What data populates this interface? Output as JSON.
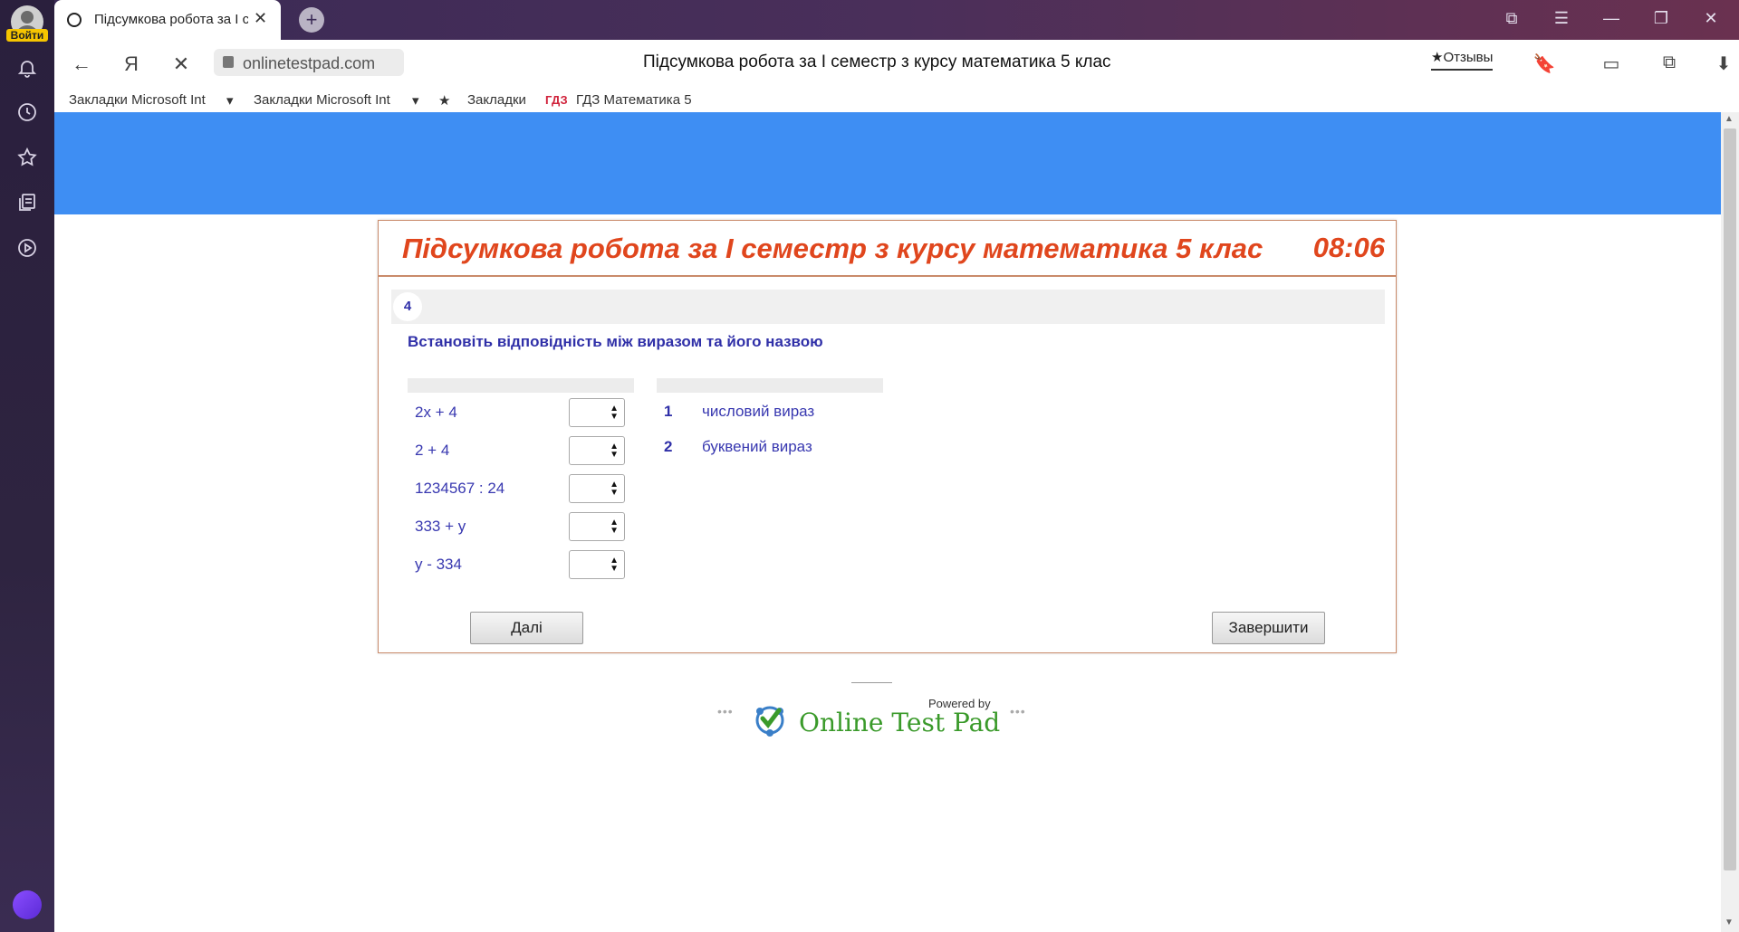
{
  "sidebar": {
    "login_label": "Войти",
    "icons": [
      "bell-icon",
      "clock-icon",
      "star-icon",
      "collections-icon",
      "play-icon"
    ]
  },
  "tab": {
    "title": "Підсумкова робота за І с",
    "close": "✕",
    "new_tab": "+"
  },
  "window_controls": {
    "collections": "⧉",
    "menu": "☰",
    "minimize": "—",
    "restore": "❐",
    "close": "✕"
  },
  "address_bar": {
    "back": "←",
    "yandex": "Я",
    "stop": "✕",
    "url": "onlinetestpad.com",
    "page_title": "Підсумкова робота за І семестр з курсу математика 5 клас",
    "reviews": "★Отзывы",
    "bookmark_icon": "🔖",
    "battery_icon": "▭",
    "translate_icon": "⧉",
    "download_icon": "⬇"
  },
  "bookmarks": [
    "Закладки Microsoft Int",
    "Закладки Microsoft Int",
    "Закладки",
    "ГДЗ Математика 5"
  ],
  "test": {
    "title": "Підсумкова робота за І семестр з курсу математика 5 клас",
    "timer": "08:06",
    "question_number": "4",
    "question_text": "Встановіть відповідність між виразом та його назвою",
    "expressions": [
      "2x + 4",
      "2 + 4",
      "1234567 : 24",
      "333 + y",
      "y - 334"
    ],
    "options": [
      {
        "num": "1",
        "text": "числовий вираз"
      },
      {
        "num": "2",
        "text": "буквений вираз"
      }
    ],
    "next_label": "Далі",
    "finish_label": "Завершити"
  },
  "footer": {
    "powered_by": "Powered by",
    "brand": "Online Test Pad",
    "dots": "•••"
  },
  "colors": {
    "banner": "#3e8ef3",
    "title_red": "#e0461d",
    "text_blue": "#3030a8",
    "brand_green": "#3a9a2a"
  }
}
